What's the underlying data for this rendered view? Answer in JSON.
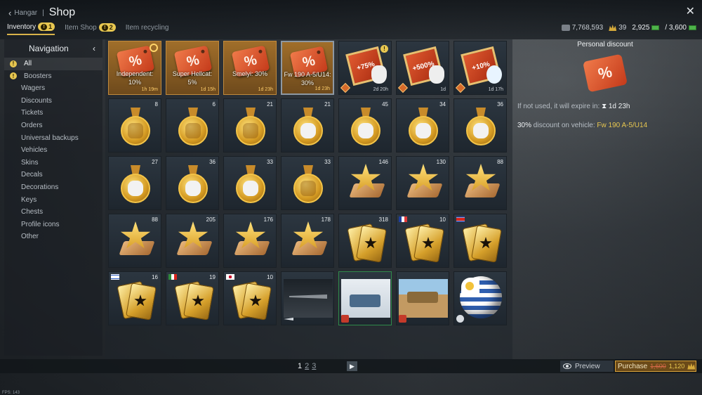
{
  "header": {
    "back_label": "Hangar",
    "title": "Shop"
  },
  "tabs": [
    {
      "label": "Inventory",
      "badge": "1"
    },
    {
      "label": "Item Shop",
      "badge": "2"
    },
    {
      "label": "Item recycling"
    }
  ],
  "currency": {
    "lions": "7,768,593",
    "gold_extra": "39",
    "warpoints": "2,925",
    "total": "/ 3,600"
  },
  "nav": {
    "heading": "Navigation",
    "items": [
      "All",
      "Boosters",
      "Wagers",
      "Discounts",
      "Tickets",
      "Orders",
      "Universal backups",
      "Vehicles",
      "Skins",
      "Decals",
      "Decorations",
      "Keys",
      "Chests",
      "Profile icons",
      "Other"
    ]
  },
  "grid": {
    "discounts": [
      {
        "name": "Independent:",
        "value": "10%",
        "time": "1h 19m"
      },
      {
        "name": "Super Hellcat:",
        "value": "5%",
        "time": "1d 15h"
      },
      {
        "name": "Smelyi: 30%",
        "value": "",
        "time": "1d 23h"
      },
      {
        "name": "Fw 190 A-5/U14:",
        "value": "30%",
        "time": "1d 23h"
      }
    ],
    "boosters": [
      {
        "label": "+75%",
        "time": "2d 20h"
      },
      {
        "label": "+500%",
        "time": "1d"
      },
      {
        "label": "+10%",
        "time": "1d 17h"
      }
    ],
    "counts_row2": [
      "8",
      "6",
      "21",
      "21",
      "45",
      "34",
      "36"
    ],
    "counts_row3": [
      "27",
      "36",
      "33",
      "33",
      "146",
      "130",
      "88"
    ],
    "counts_row4": [
      "88",
      "205",
      "176",
      "178",
      "318",
      "10",
      ""
    ],
    "counts_row5": [
      "16",
      "19",
      "10"
    ]
  },
  "detail": {
    "title": "Personal discount",
    "expire_text": "If not used, it will expire in:",
    "expire_time": "1d 23h",
    "discount_value": "30%",
    "discount_text": "discount on vehicle:",
    "vehicle": "Fw 190 A-5/U14"
  },
  "pagination": {
    "pages": [
      "1",
      "2",
      "3"
    ]
  },
  "actions": {
    "preview": "Preview",
    "purchase": "Purchase",
    "old_price": "1,600",
    "new_price": "1,120"
  },
  "fps": "FPS: 143"
}
